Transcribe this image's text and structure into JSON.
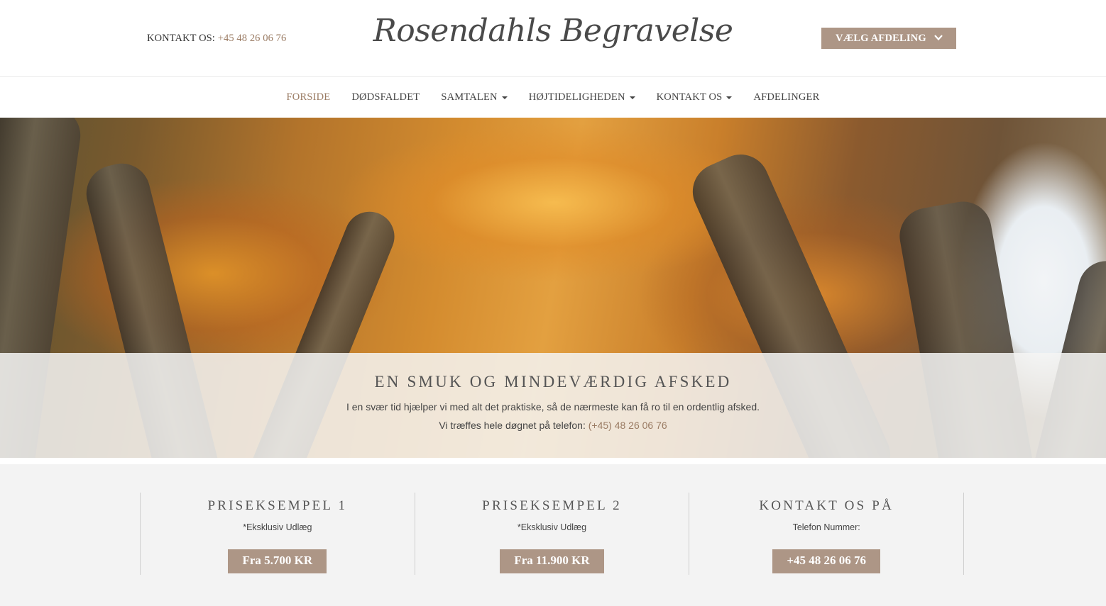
{
  "header": {
    "contact_label": "KONTAKT OS:",
    "contact_phone": "+45 48 26 06 76",
    "logo_text": "Rosendahls Begravelse",
    "department_button": "VÆLG AFDELING"
  },
  "nav": {
    "items": [
      {
        "label": "FORSIDE"
      },
      {
        "label": "DØDSFALDET"
      },
      {
        "label": "SAMTALEN"
      },
      {
        "label": "HØJTIDELIGHEDEN"
      },
      {
        "label": "KONTAKT OS"
      },
      {
        "label": "AFDELINGER"
      }
    ]
  },
  "hero": {
    "title": "EN SMUK OG MINDEVÆRDIG AFSKED",
    "text": "I en svær tid hjælper vi med alt det praktiske, så de nærmeste kan få ro til en ordentlig afsked.",
    "phone_prefix": "Vi træffes hele døgnet på telefon:",
    "phone": "(+45) 48 26 06 76"
  },
  "columns": [
    {
      "title": "PRISEKSEMPEL 1",
      "sub": "*Eksklusiv Udlæg",
      "button": "Fra 5.700 KR"
    },
    {
      "title": "PRISEKSEMPEL 2",
      "sub": "*Eksklusiv Udlæg",
      "button": "Fra 11.900 KR"
    },
    {
      "title": "KONTAKT OS PÅ",
      "sub": "Telefon Nummer:",
      "button": "+45 48 26 06 76"
    }
  ],
  "colors": {
    "accent": "#ad9686",
    "link": "#9a7b63"
  }
}
